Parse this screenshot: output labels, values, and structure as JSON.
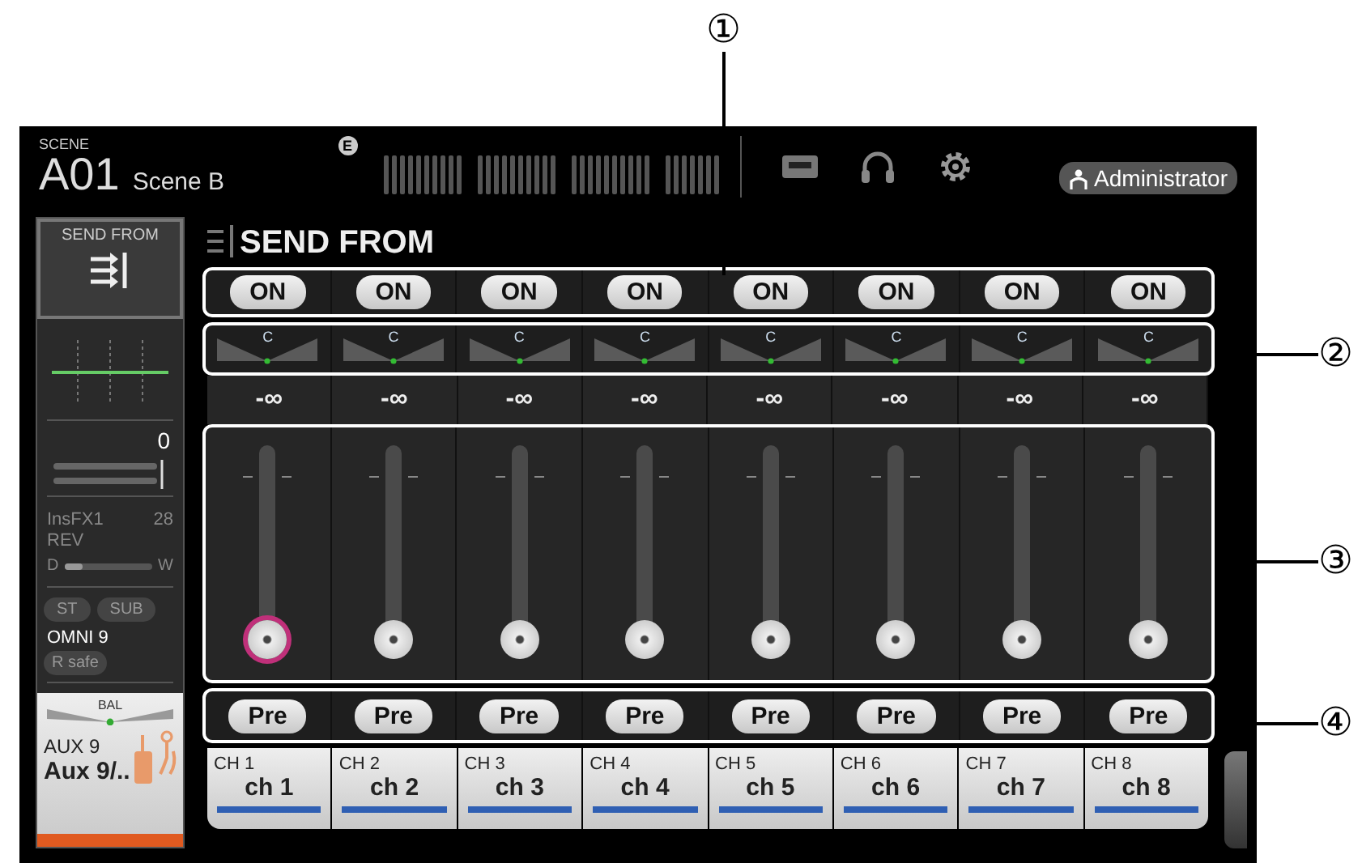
{
  "header": {
    "scene_label": "SCENE",
    "scene_number": "A01",
    "scene_name": "Scene B",
    "badge": "E",
    "user": "Administrator"
  },
  "left_strip": {
    "send_from_label": "SEND FROM",
    "gain": "0",
    "insert": "InsFX1",
    "insert_value": "28",
    "effect": "REV",
    "dry": "D",
    "wet": "W",
    "mix": {
      "level": 0.2
    },
    "buttons": [
      {
        "label": "ST",
        "on": false
      },
      {
        "label": "SUB",
        "on": false
      }
    ],
    "input": "OMNI 9",
    "rsafe": {
      "label": "R safe",
      "on": false
    },
    "bal": "BAL",
    "bus_id": "AUX 9",
    "bus_name": "Aux 9/.."
  },
  "title": "SEND FROM",
  "channels": [
    {
      "on_label": "ON",
      "on": true,
      "pan": "C",
      "send": "-∞",
      "level": 0,
      "selected": true,
      "pre_label": "Pre",
      "pre": true,
      "id": "CH 1",
      "name": "ch 1"
    },
    {
      "on_label": "ON",
      "on": true,
      "pan": "C",
      "send": "-∞",
      "level": 0,
      "selected": false,
      "pre_label": "Pre",
      "pre": true,
      "id": "CH 2",
      "name": "ch 2"
    },
    {
      "on_label": "ON",
      "on": true,
      "pan": "C",
      "send": "-∞",
      "level": 0,
      "selected": false,
      "pre_label": "Pre",
      "pre": true,
      "id": "CH 3",
      "name": "ch 3"
    },
    {
      "on_label": "ON",
      "on": true,
      "pan": "C",
      "send": "-∞",
      "level": 0,
      "selected": false,
      "pre_label": "Pre",
      "pre": true,
      "id": "CH 4",
      "name": "ch 4"
    },
    {
      "on_label": "ON",
      "on": true,
      "pan": "C",
      "send": "-∞",
      "level": 0,
      "selected": false,
      "pre_label": "Pre",
      "pre": true,
      "id": "CH 5",
      "name": "ch 5"
    },
    {
      "on_label": "ON",
      "on": true,
      "pan": "C",
      "send": "-∞",
      "level": 0,
      "selected": false,
      "pre_label": "Pre",
      "pre": true,
      "id": "CH 6",
      "name": "ch 6"
    },
    {
      "on_label": "ON",
      "on": true,
      "pan": "C",
      "send": "-∞",
      "level": 0,
      "selected": false,
      "pre_label": "Pre",
      "pre": true,
      "id": "CH 7",
      "name": "ch 7"
    },
    {
      "on_label": "ON",
      "on": true,
      "pan": "C",
      "send": "-∞",
      "level": 0,
      "selected": false,
      "pre_label": "Pre",
      "pre": true,
      "id": "CH 8",
      "name": "ch 8"
    }
  ],
  "callouts": [
    "①",
    "②",
    "③",
    "④"
  ]
}
